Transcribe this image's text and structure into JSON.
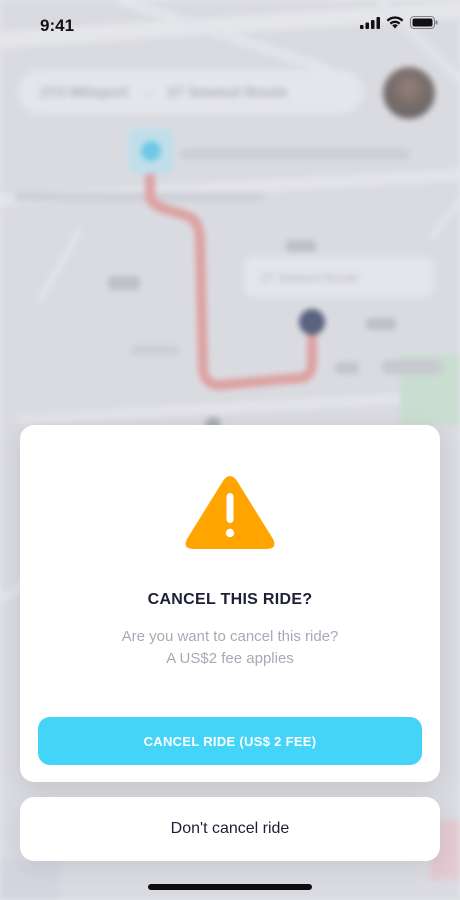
{
  "status_bar": {
    "time": "9:41",
    "icons": [
      "signal-icon",
      "wifi-icon",
      "battery-icon"
    ]
  },
  "map": {
    "route_color": "#e88a86",
    "start_color": "#3cc8f0",
    "end_color": "#1e2a52"
  },
  "modal": {
    "icon": "warning-icon",
    "icon_color": "#ffa400",
    "title": "CANCEL THIS RIDE?",
    "message_line1": "Are you want to cancel this ride?",
    "message_line2": "A US$2 fee applies",
    "confirm_label": "CANCEL RIDE (US$ 2 FEE)",
    "confirm_color": "#43d4f7"
  },
  "dismiss_label": "Don't cancel ride"
}
